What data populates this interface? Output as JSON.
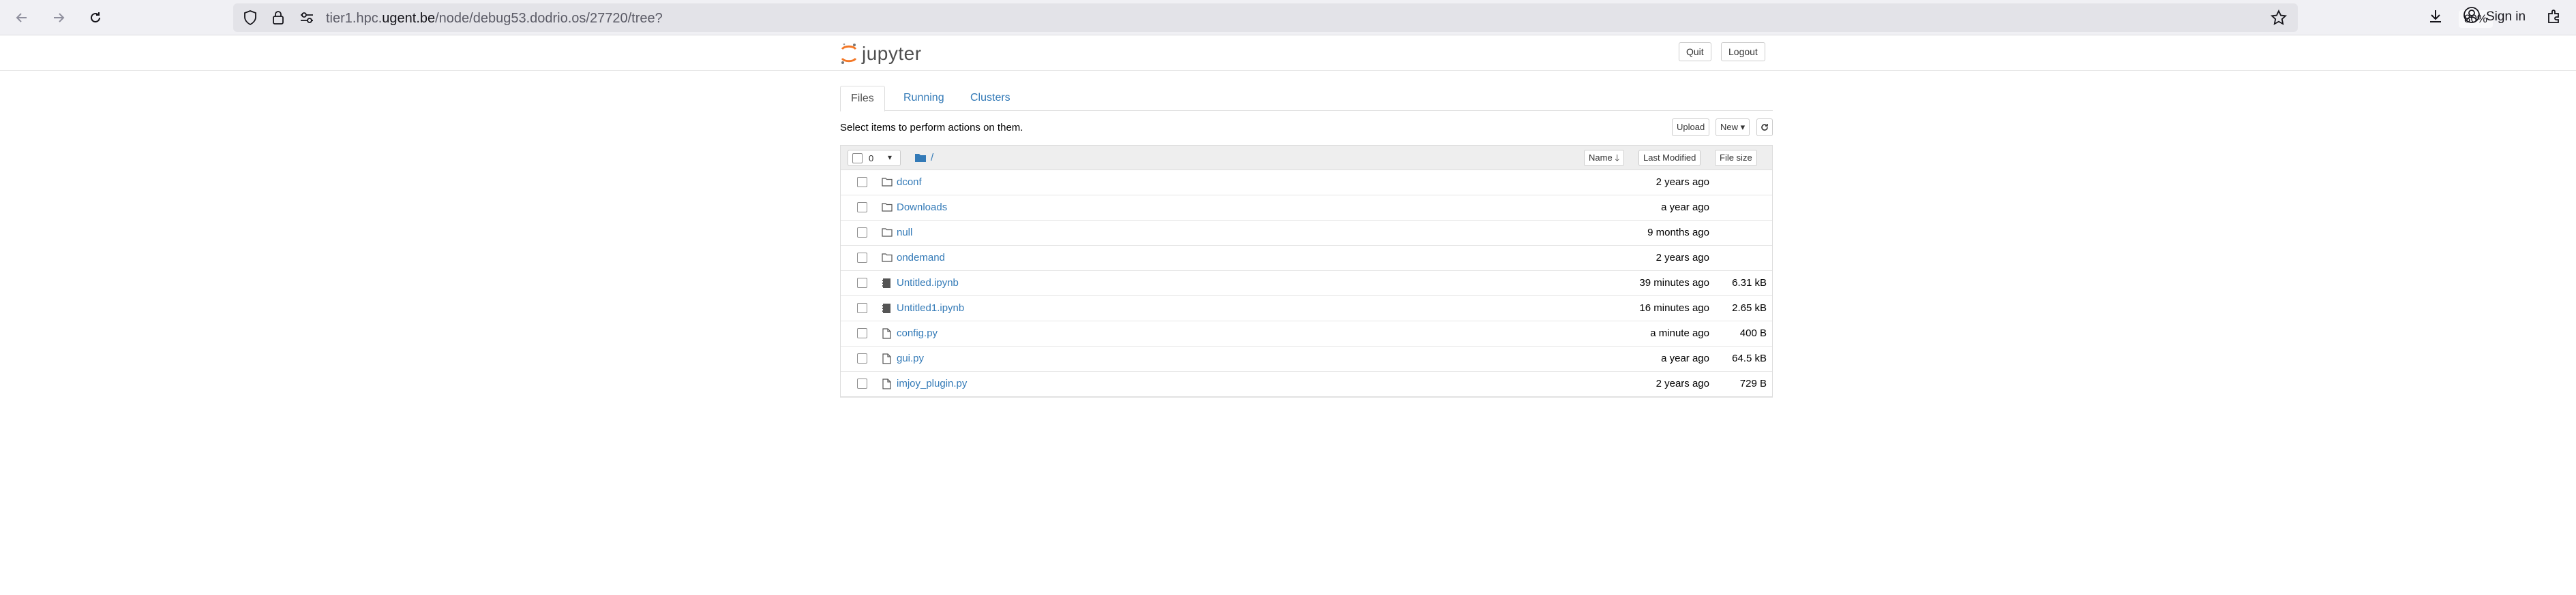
{
  "browser": {
    "url_prefix": "tier1.hpc.",
    "url_host": "ugent.be",
    "url_path": "/node/debug53.dodrio.os/27720/tree?",
    "zoom": "80%",
    "sign_in": "Sign in"
  },
  "header": {
    "logo_text": "jupyter",
    "quit_label": "Quit",
    "logout_label": "Logout"
  },
  "tabs": [
    {
      "label": "Files"
    },
    {
      "label": "Running"
    },
    {
      "label": "Clusters"
    }
  ],
  "toolbar": {
    "instruction": "Select items to perform actions on them.",
    "upload_label": "Upload",
    "new_label": "New"
  },
  "list_header": {
    "selected_count": "0",
    "path": "/",
    "name_label": "Name",
    "last_modified_label": "Last Modified",
    "file_size_label": "File size"
  },
  "files": [
    {
      "name": "dconf",
      "type": "folder",
      "modified": "2 years ago",
      "size": ""
    },
    {
      "name": "Downloads",
      "type": "folder",
      "modified": "a year ago",
      "size": ""
    },
    {
      "name": "null",
      "type": "folder",
      "modified": "9 months ago",
      "size": ""
    },
    {
      "name": "ondemand",
      "type": "folder",
      "modified": "2 years ago",
      "size": ""
    },
    {
      "name": "Untitled.ipynb",
      "type": "notebook",
      "modified": "39 minutes ago",
      "size": "6.31 kB"
    },
    {
      "name": "Untitled1.ipynb",
      "type": "notebook",
      "modified": "16 minutes ago",
      "size": "2.65 kB"
    },
    {
      "name": "config.py",
      "type": "file",
      "modified": "a minute ago",
      "size": "400 B"
    },
    {
      "name": "gui.py",
      "type": "file",
      "modified": "a year ago",
      "size": "64.5 kB"
    },
    {
      "name": "imjoy_plugin.py",
      "type": "file",
      "modified": "2 years ago",
      "size": "729 B"
    }
  ],
  "colors": {
    "link": "#337ab7",
    "logo_orange": "#f37726"
  }
}
